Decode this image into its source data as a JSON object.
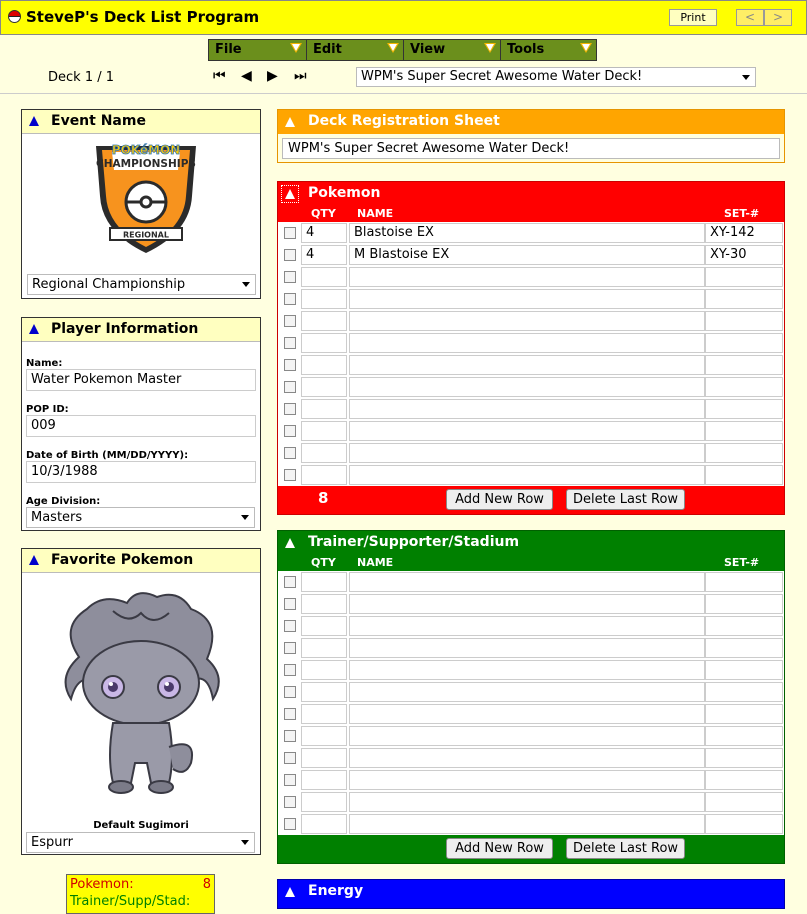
{
  "app": {
    "title": "SteveP's Deck List Program",
    "print_label": "Print",
    "prev_label": "<",
    "next_label": ">"
  },
  "menu": [
    {
      "label": "File"
    },
    {
      "label": "Edit"
    },
    {
      "label": "View"
    },
    {
      "label": "Tools"
    }
  ],
  "deck_nav": {
    "counter": "Deck 1 / 1",
    "first": "⏮",
    "prev": "◀",
    "next": "▶",
    "last": "⏭",
    "selected_deck": "WPM's Super Secret Awesome Water Deck!"
  },
  "event": {
    "title": "Event Name",
    "logo_word1": "POKéMON",
    "logo_word2": "CHAMPIONSHIPS",
    "logo_banner": "REGIONAL",
    "selected": "Regional Championship"
  },
  "player": {
    "title": "Player Information",
    "name_label": "Name:",
    "name": "Water Pokemon Master",
    "pop_label": "POP ID:",
    "pop_id": "009",
    "dob_label": "Date of Birth (MM/DD/YYYY):",
    "dob": "10/3/1988",
    "age_label": "Age Division:",
    "age_division": "Masters"
  },
  "favorite": {
    "title": "Favorite Pokemon",
    "caption": "Default Sugimori",
    "selected": "Espurr"
  },
  "summary": {
    "pokemon_label": "Pokemon:",
    "pokemon_count": "8",
    "trainer_label": "Trainer/Supp/Stad:"
  },
  "registration": {
    "title": "Deck Registration Sheet",
    "deck_name": "WPM's Super Secret Awesome Water Deck!"
  },
  "pokemon": {
    "title": "Pokemon",
    "qty_header": "QTY",
    "name_header": "NAME",
    "set_header": "SET-#",
    "rows": [
      {
        "qty": "4",
        "name": "Blastoise EX",
        "set": "XY-142"
      },
      {
        "qty": "4",
        "name": "M Blastoise EX",
        "set": "XY-30"
      },
      {
        "qty": "",
        "name": "",
        "set": ""
      },
      {
        "qty": "",
        "name": "",
        "set": ""
      },
      {
        "qty": "",
        "name": "",
        "set": ""
      },
      {
        "qty": "",
        "name": "",
        "set": ""
      },
      {
        "qty": "",
        "name": "",
        "set": ""
      },
      {
        "qty": "",
        "name": "",
        "set": ""
      },
      {
        "qty": "",
        "name": "",
        "set": ""
      },
      {
        "qty": "",
        "name": "",
        "set": ""
      },
      {
        "qty": "",
        "name": "",
        "set": ""
      },
      {
        "qty": "",
        "name": "",
        "set": ""
      }
    ],
    "total": "8",
    "add_label": "Add New Row",
    "delete_label": "Delete Last Row"
  },
  "trainer": {
    "title": "Trainer/Supporter/Stadium",
    "qty_header": "QTY",
    "name_header": "NAME",
    "set_header": "SET-#",
    "rows": [
      {
        "qty": "",
        "name": "",
        "set": ""
      },
      {
        "qty": "",
        "name": "",
        "set": ""
      },
      {
        "qty": "",
        "name": "",
        "set": ""
      },
      {
        "qty": "",
        "name": "",
        "set": ""
      },
      {
        "qty": "",
        "name": "",
        "set": ""
      },
      {
        "qty": "",
        "name": "",
        "set": ""
      },
      {
        "qty": "",
        "name": "",
        "set": ""
      },
      {
        "qty": "",
        "name": "",
        "set": ""
      },
      {
        "qty": "",
        "name": "",
        "set": ""
      },
      {
        "qty": "",
        "name": "",
        "set": ""
      },
      {
        "qty": "",
        "name": "",
        "set": ""
      },
      {
        "qty": "",
        "name": "",
        "set": ""
      }
    ],
    "add_label": "Add New Row",
    "delete_label": "Delete Last Row"
  },
  "energy": {
    "title": "Energy"
  },
  "colors": {
    "pokemon": "#ff0000",
    "trainer": "#008000",
    "energy": "#0000ff",
    "registration": "#ffa500",
    "titlebar": "#ffff00"
  }
}
